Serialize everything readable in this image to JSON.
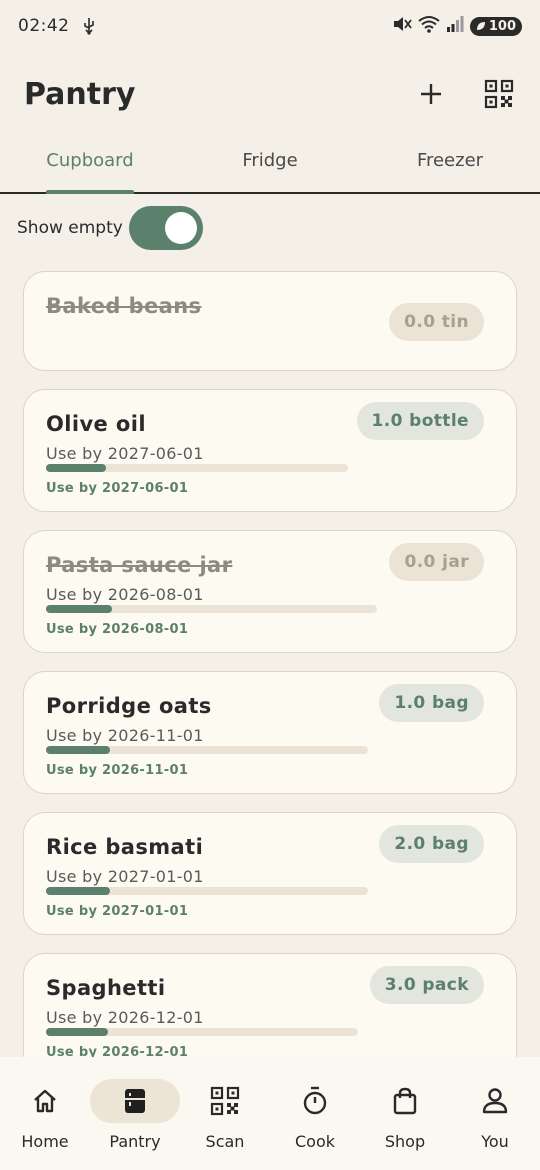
{
  "status": {
    "time": "02:42",
    "battery": "100"
  },
  "header": {
    "title": "Pantry"
  },
  "tabs": [
    {
      "label": "Cupboard",
      "active": true
    },
    {
      "label": "Fridge",
      "active": false
    },
    {
      "label": "Freezer",
      "active": false
    }
  ],
  "filter": {
    "show_empty_label": "Show empty",
    "show_empty_on": true
  },
  "items": [
    {
      "name": "Baked beans",
      "qty": "0.0 tin",
      "empty": true
    },
    {
      "name": "Olive oil",
      "qty": "1.0 bottle",
      "empty": false,
      "use_by": "Use by 2027-06-01",
      "use_by_small": "Use by 2027-06-01",
      "remaining": 0.2
    },
    {
      "name": "Pasta sauce jar",
      "qty": "0.0 jar",
      "empty": true,
      "use_by": "Use by 2026-08-01",
      "use_by_small": "Use by 2026-08-01",
      "remaining": 0.2
    },
    {
      "name": "Porridge oats",
      "qty": "1.0 bag",
      "empty": false,
      "use_by": "Use by 2026-11-01",
      "use_by_small": "Use by 2026-11-01",
      "remaining": 0.2
    },
    {
      "name": "Rice basmati",
      "qty": "2.0 bag",
      "empty": false,
      "use_by": "Use by 2027-01-01",
      "use_by_small": "Use by 2027-01-01",
      "remaining": 0.2
    },
    {
      "name": "Spaghetti",
      "qty": "3.0 pack",
      "empty": false,
      "use_by": "Use by 2026-12-01",
      "use_by_small": "Use by 2026-12-01",
      "remaining": 0.2
    }
  ],
  "nav": [
    {
      "label": "Home",
      "icon": "home-icon"
    },
    {
      "label": "Pantry",
      "icon": "pantry-icon",
      "active": true
    },
    {
      "label": "Scan",
      "icon": "qr-scan-icon"
    },
    {
      "label": "Cook",
      "icon": "timer-icon"
    },
    {
      "label": "Shop",
      "icon": "shopping-bag-icon"
    },
    {
      "label": "You",
      "icon": "person-icon"
    }
  ],
  "colors": {
    "accent": "#5b806c",
    "background": "#f4f0e8",
    "card": "#fdfaf2"
  }
}
